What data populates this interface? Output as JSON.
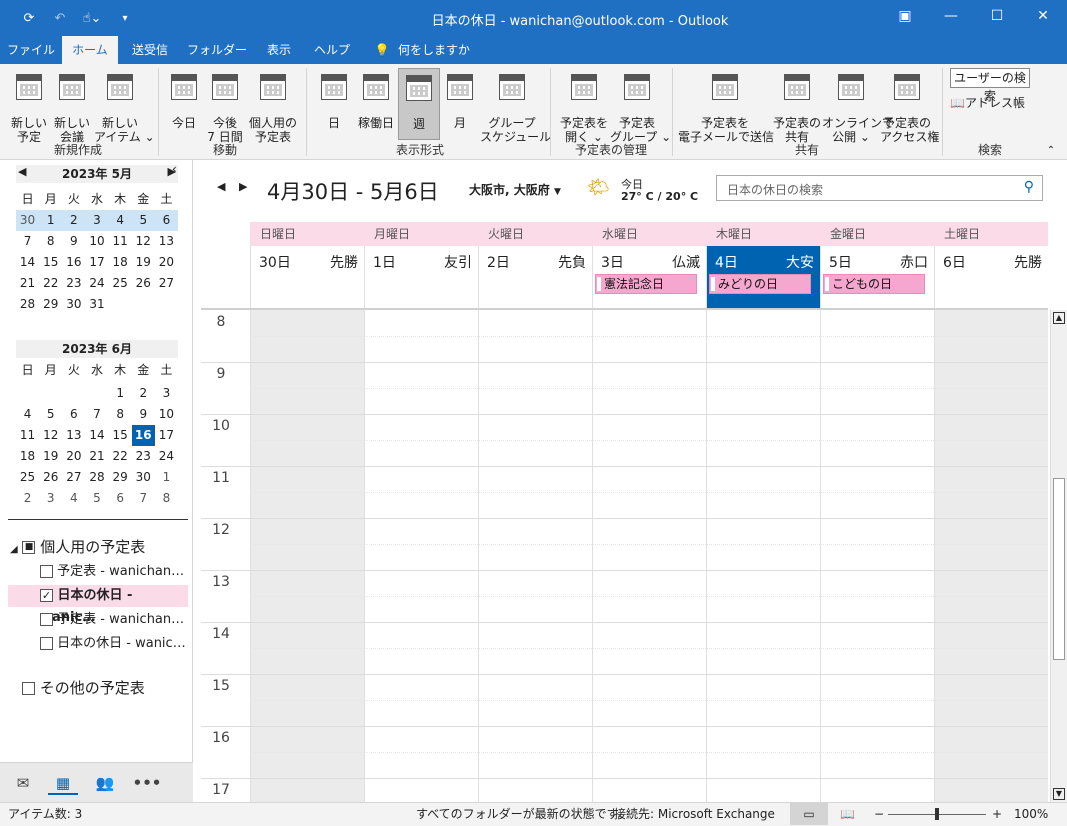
{
  "title": "日本の休日 - wanichan@outlook.com  -  Outlook",
  "tabs": [
    "ファイル",
    "ホーム",
    "送受信",
    "フォルダー",
    "表示",
    "ヘルプ",
    "何をしますか"
  ],
  "ribbon": {
    "new_mail": "新しい\n予定",
    "new_meeting": "新しい\n会議",
    "new_item": "新しい\nアイテム ⌄",
    "group_new": "新規作成",
    "today": "今日",
    "next7": "今後\n7 日間",
    "personal": "個人用の\n予定表",
    "group_move": "移動",
    "day": "日",
    "workweek": "稼働日",
    "week": "週",
    "month": "月",
    "group_schedule": "グループ\nスケジュール",
    "group_view": "表示形式",
    "open_cal": "予定表を\n開く ⌄",
    "cal_groups": "予定表\nグループ ⌄",
    "group_manage": "予定表の管理",
    "email_cal": "予定表を\n電子メールで送信",
    "share_cal": "予定表の\n共有",
    "publish": "オンラインで\n公開 ⌄",
    "permissions": "予定表の\nアクセス権",
    "group_share": "共有",
    "search_people": "ユーザーの検索",
    "address_book": "アドレス帳",
    "group_find": "検索"
  },
  "mini1": {
    "header": "2023年 5月",
    "weekdays": [
      "日",
      "月",
      "火",
      "水",
      "木",
      "金",
      "土"
    ],
    "rows": [
      [
        "30",
        "1",
        "2",
        "3",
        "4",
        "5",
        "6"
      ],
      [
        "7",
        "8",
        "9",
        "10",
        "11",
        "12",
        "13"
      ],
      [
        "14",
        "15",
        "16",
        "17",
        "18",
        "19",
        "20"
      ],
      [
        "21",
        "22",
        "23",
        "24",
        "25",
        "26",
        "27"
      ],
      [
        "28",
        "29",
        "30",
        "31",
        "",
        "",
        ""
      ]
    ]
  },
  "mini2": {
    "header": "2023年 6月",
    "weekdays": [
      "日",
      "月",
      "火",
      "水",
      "木",
      "金",
      "土"
    ],
    "rows": [
      [
        "",
        "",
        "",
        "",
        "1",
        "2",
        "3"
      ],
      [
        "4",
        "5",
        "6",
        "7",
        "8",
        "9",
        "10"
      ],
      [
        "11",
        "12",
        "13",
        "14",
        "15",
        "16",
        "17"
      ],
      [
        "18",
        "19",
        "20",
        "21",
        "22",
        "23",
        "24"
      ],
      [
        "25",
        "26",
        "27",
        "28",
        "29",
        "30",
        "1"
      ],
      [
        "2",
        "3",
        "4",
        "5",
        "6",
        "7",
        "8"
      ]
    ]
  },
  "folders": {
    "group": "個人用の予定表",
    "items": [
      "予定表 - wanichan…",
      "日本の休日 - wanic…",
      "予定表 - wanichan…",
      "日本の休日 - wanic…"
    ],
    "other": "その他の予定表"
  },
  "header": {
    "range": "4月30日 - 5月6日",
    "location": "大阪市, 大阪府",
    "weather_label": "今日",
    "weather_temp": "27° C / 20° C",
    "search_placeholder": "日本の休日の検索"
  },
  "days": [
    {
      "name": "日曜日",
      "num": "30日",
      "rokuyo": "先勝",
      "event": ""
    },
    {
      "name": "月曜日",
      "num": "1日",
      "rokuyo": "友引",
      "event": ""
    },
    {
      "name": "火曜日",
      "num": "2日",
      "rokuyo": "先負",
      "event": ""
    },
    {
      "name": "水曜日",
      "num": "3日",
      "rokuyo": "仏滅",
      "event": "憲法記念日"
    },
    {
      "name": "木曜日",
      "num": "4日",
      "rokuyo": "大安",
      "event": "みどりの日"
    },
    {
      "name": "金曜日",
      "num": "5日",
      "rokuyo": "赤口",
      "event": "こどもの日"
    },
    {
      "name": "土曜日",
      "num": "6日",
      "rokuyo": "先勝",
      "event": ""
    }
  ],
  "hours": [
    "8",
    "9",
    "10",
    "11",
    "12",
    "13",
    "14",
    "15",
    "16",
    "17"
  ],
  "status": {
    "items": "アイテム数: 3",
    "sync": "すべてのフォルダーが最新の状態です。",
    "conn": "接続先: Microsoft Exchange",
    "zoom": "100%"
  },
  "colors": {
    "accent": "#1f6fc2",
    "today": "#0063b1",
    "holiday": "#f6a7d0"
  }
}
